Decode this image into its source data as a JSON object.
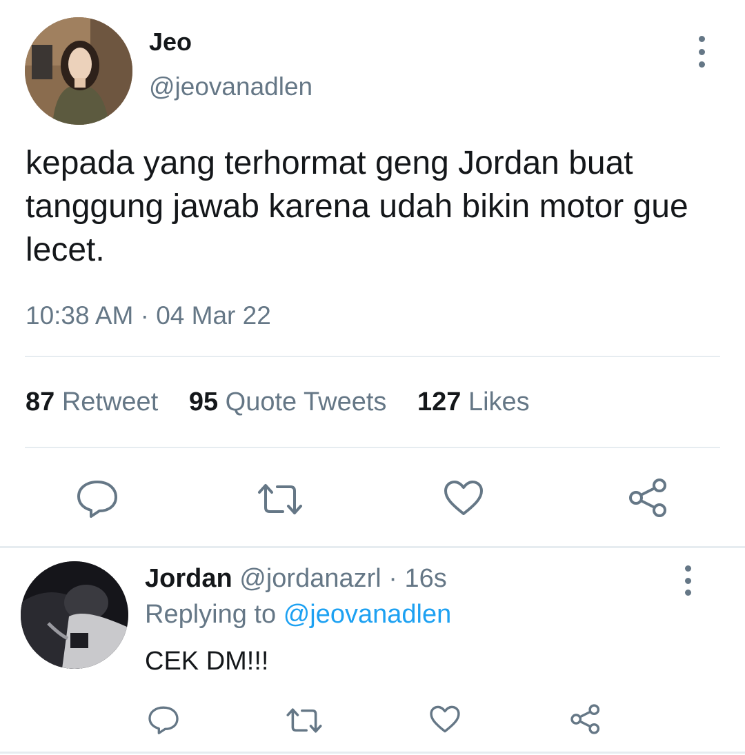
{
  "tweet": {
    "author_name": "Jeo",
    "author_handle": "@jeovanadlen",
    "text": "kepada yang terhormat geng Jordan buat tanggung jawab karena udah bikin motor gue lecet.",
    "timestamp": "10:38 AM · 04 Mar 22",
    "stats": {
      "retweets_count": "87",
      "retweets_label": "Retweet",
      "quotes_count": "95",
      "quotes_label": "Quote Tweets",
      "likes_count": "127",
      "likes_label": "Likes"
    },
    "actions": [
      "reply-icon",
      "retweet-icon",
      "like-icon",
      "share-icon"
    ]
  },
  "reply": {
    "author_name": "Jordan",
    "author_handle": "@jordanazrl",
    "time": "16s",
    "separator": "·",
    "replying_prefix": "Replying to",
    "replying_handle": "@jeovanadlen",
    "text": "CEK DM!!!",
    "actions": [
      "reply-icon",
      "retweet-icon",
      "like-icon",
      "share-icon"
    ]
  },
  "colors": {
    "text_primary": "#14171a",
    "text_secondary": "#657786",
    "link": "#1da1f2",
    "divider": "#e6ecf0"
  }
}
